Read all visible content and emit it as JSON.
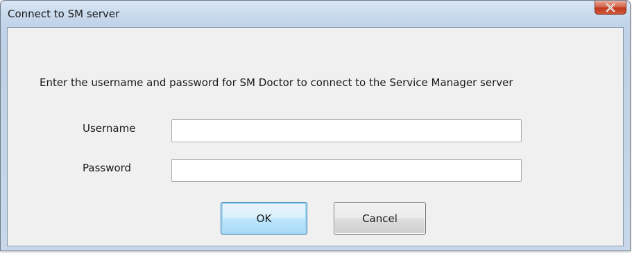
{
  "window": {
    "title": "Connect to SM server"
  },
  "close_button": {
    "label": "X",
    "icon": "close-icon"
  },
  "dialog": {
    "instruction": "Enter the username and password for SM Doctor to connect to the Service Manager server",
    "username_label": "Username",
    "username_value": "",
    "password_label": "Password",
    "password_value": ""
  },
  "buttons": {
    "ok_label": "OK",
    "cancel_label": "Cancel"
  },
  "colors": {
    "frame": "#c3d5ea",
    "client_bg": "#f0f0f0",
    "close_button": "#c0391b",
    "default_button_border": "#3c7fb1"
  }
}
